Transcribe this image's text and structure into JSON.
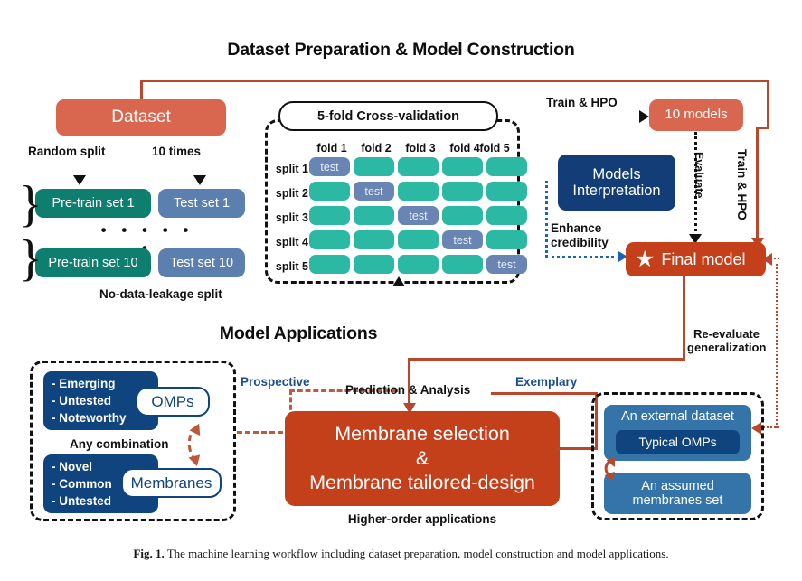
{
  "figure": {
    "caption_label": "Fig. 1.",
    "caption_text": "The machine learning workflow including dataset preparation, model construction and model applications."
  },
  "sections": {
    "top_title": "Dataset Preparation & Model Construction",
    "bottom_title": "Model Applications"
  },
  "top": {
    "dataset_box": "Dataset",
    "random_split_label": "Random split",
    "times_label": "10 times",
    "pretrain_set_1": "Pre-train set 1",
    "test_set_1": "Test set 1",
    "pretrain_set_10": "Pre-train set 10",
    "test_set_10": "Test set 10",
    "ellipsis": "• • • • • •",
    "no_leakage_label": "No-data-leakage split",
    "cv_pill": "5-fold Cross-validation",
    "train_hpo_top": "Train & HPO",
    "train_hpo_right": "Train & HPO",
    "ten_models": "10 models",
    "evaluate_label": "Evaluate",
    "models_interpretation_line1": "Models",
    "models_interpretation_line2": "Interpretation",
    "enhance_line1": "Enhance",
    "enhance_line2": "credibility",
    "final_model": "Final model",
    "star_glyph": "★"
  },
  "cv_grid": {
    "fold_headers": [
      "fold 1",
      "fold 2",
      "fold 3",
      "fold 4",
      "fold 5"
    ],
    "split_labels": [
      "split 1",
      "split 2",
      "split 3",
      "split 4",
      "split 5"
    ],
    "test_cell_label": "test",
    "test_positions": [
      0,
      1,
      2,
      3,
      4
    ]
  },
  "applications": {
    "omps_tags": [
      "-  Emerging",
      "-  Untested",
      "-  Noteworthy"
    ],
    "omps_label": "OMPs",
    "any_combination": "Any combination",
    "membranes_tags": [
      "-  Novel",
      "-  Common",
      "-  Untested"
    ],
    "membranes_label": "Membranes",
    "prospective_label": "Prospective",
    "prediction_label": "Prediction & Analysis",
    "exemplary_label": "Exemplary",
    "center_line1": "Membrane selection",
    "center_line2": "&",
    "center_line3": "Membrane tailored-design",
    "higher_order_label": "Higher-order applications",
    "reevaluate_line1": "Re-evaluate",
    "reevaluate_line2": "generalization",
    "external_dataset": "An external dataset",
    "typical_omps": "Typical OMPs",
    "assumed_line1": "An assumed",
    "assumed_line2": "membranes set"
  },
  "colors": {
    "salmon": "#d9674f",
    "red": "#c4401b",
    "teal": "#0e7f6e",
    "cell_teal": "#2bb9a4",
    "slate": "#5b7fae",
    "navy": "#123d76",
    "steel": "#3574a8",
    "line_red": "#b9472c",
    "line_blue": "#1b63b5"
  }
}
